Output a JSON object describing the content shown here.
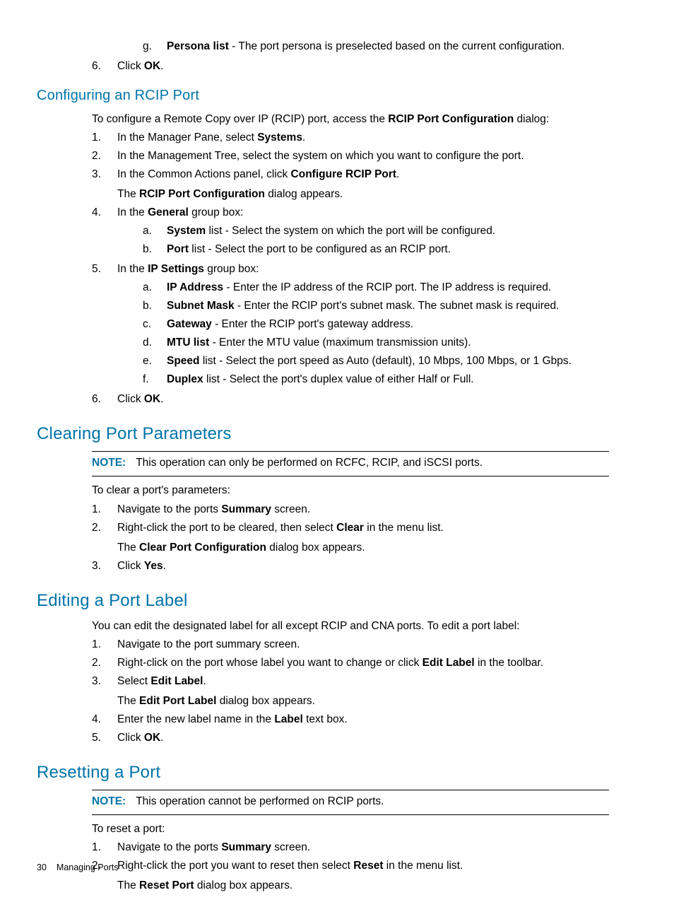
{
  "intro_sub": {
    "g_marker": "g.",
    "g_bold": "Persona list",
    "g_rest": " - The port persona is preselected based on the current configuration."
  },
  "intro_6": {
    "marker": "6.",
    "pre": "Click ",
    "bold": "OK",
    "post": "."
  },
  "rcip": {
    "heading": "Configuring an RCIP Port",
    "para_pre": "To configure a Remote Copy over IP (RCIP) port, access the ",
    "para_bold": "RCIP Port Configuration",
    "para_post": " dialog:",
    "s1": {
      "m": "1.",
      "pre": "In the Manager Pane, select ",
      "b": "Systems",
      "post": "."
    },
    "s2": {
      "m": "2.",
      "text": "In the Management Tree, select the system on which you want to configure the port."
    },
    "s3": {
      "m": "3.",
      "pre": "In the Common Actions panel, click ",
      "b": "Configure RCIP Port",
      "post": ".",
      "sub_pre": "The ",
      "sub_b": "RCIP Port Configuration",
      "sub_post": " dialog appears."
    },
    "s4": {
      "m": "4.",
      "pre": "In the ",
      "b": "General",
      "post": " group box:",
      "a": {
        "m": "a.",
        "b": "System",
        "rest": " list - Select the system on which the port will be configured."
      },
      "b_item": {
        "m": "b.",
        "b": "Port",
        "rest": " list - Select the port to be configured as an RCIP port."
      }
    },
    "s5": {
      "m": "5.",
      "pre": "In the ",
      "b": "IP Settings",
      "post": " group box:",
      "a": {
        "m": "a.",
        "b": "IP Address ",
        "rest": " - Enter the IP address of the RCIP port. The IP address is required."
      },
      "b_item": {
        "m": "b.",
        "b": "Subnet Mask",
        "rest": " - Enter the RCIP port's subnet mask. The subnet mask is required."
      },
      "c": {
        "m": "c.",
        "b": "Gateway",
        "rest": " - Enter the RCIP port's gateway address."
      },
      "d": {
        "m": "d.",
        "b": "MTU list",
        "rest": " - Enter the MTU value (maximum transmission units)."
      },
      "e": {
        "m": "e.",
        "b": "Speed",
        "rest": " list - Select the port speed as Auto (default), 10 Mbps, 100 Mbps, or 1 Gbps."
      },
      "f": {
        "m": "f.",
        "b": "Duplex",
        "rest": " list - Select the port's duplex value of either Half or Full."
      }
    },
    "s6": {
      "m": "6.",
      "pre": "Click ",
      "b": "OK",
      "post": "."
    }
  },
  "clear": {
    "heading": "Clearing Port Parameters",
    "note_label": "NOTE:",
    "note_text": "This operation can only be performed on RCFC, RCIP, and iSCSI ports.",
    "para": "To clear a port's parameters:",
    "s1": {
      "m": "1.",
      "pre": "Navigate to the ports ",
      "b": "Summary",
      "post": " screen."
    },
    "s2": {
      "m": "2.",
      "pre": "Right-click the port to be cleared, then select ",
      "b": "Clear",
      "post": " in the menu list.",
      "sub_pre": "The ",
      "sub_b": "Clear Port Configuration",
      "sub_post": " dialog box appears."
    },
    "s3": {
      "m": "3.",
      "pre": "Click ",
      "b": "Yes",
      "post": "."
    }
  },
  "edit": {
    "heading": "Editing a Port Label",
    "para": "You can edit the designated label for all except RCIP and CNA ports. To edit a port label:",
    "s1": {
      "m": "1.",
      "text": "Navigate to the port summary screen."
    },
    "s2": {
      "m": "2.",
      "pre": "Right-click on the port whose label you want to change or click ",
      "b": "Edit Label",
      "post": " in the toolbar."
    },
    "s3": {
      "m": "3.",
      "pre": "Select ",
      "b": "Edit Label",
      "post": ".",
      "sub_pre": "The ",
      "sub_b": "Edit Port Label",
      "sub_post": " dialog box appears."
    },
    "s4": {
      "m": "4.",
      "pre": "Enter the new label name in the ",
      "b": "Label",
      "post": " text box."
    },
    "s5": {
      "m": "5.",
      "pre": "Click ",
      "b": "OK",
      "post": "."
    }
  },
  "reset": {
    "heading": "Resetting a Port",
    "note_label": "NOTE:",
    "note_text": "This operation cannot be performed on RCIP ports.",
    "para": "To reset a port:",
    "s1": {
      "m": "1.",
      "pre": "Navigate to the ports ",
      "b": "Summary",
      "post": " screen."
    },
    "s2": {
      "m": "2.",
      "pre": "Right-click the port you want to reset then select ",
      "b": "Reset",
      "post": " in the menu list.",
      "sub_pre": "The ",
      "sub_b": "Reset Port",
      "sub_post": " dialog box appears."
    }
  },
  "footer": {
    "page": "30",
    "title": "Managing Ports"
  }
}
